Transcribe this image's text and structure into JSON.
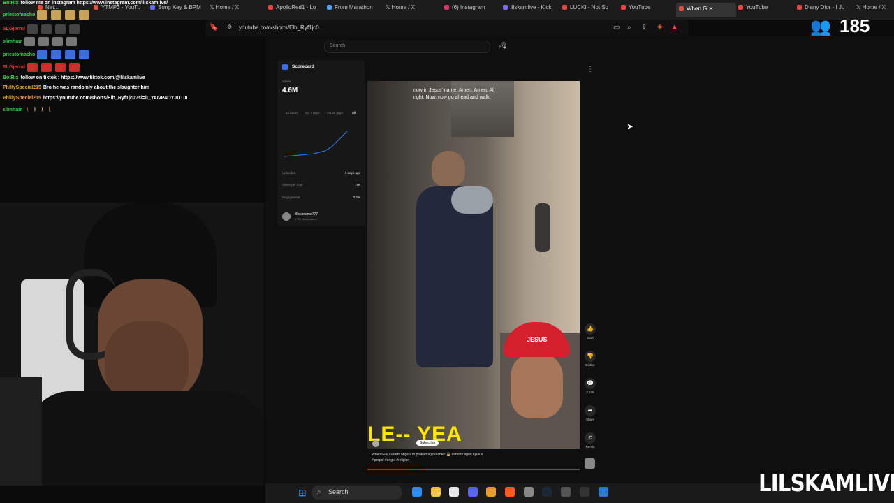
{
  "browser": {
    "tabs": [
      {
        "label": "Nat...",
        "color": "#e7473c"
      },
      {
        "label": "YTMP3 - YouTu",
        "color": "#e7473c"
      },
      {
        "label": "Song Key & BPM",
        "color": "#5b6cff"
      },
      {
        "label": "Home / X",
        "color": "#ffffff"
      },
      {
        "label": "ApolloRed1 - Lo",
        "color": "#e7473c"
      },
      {
        "label": "From Marathon",
        "color": "#4aa3ff"
      },
      {
        "label": "Home / X",
        "color": "#ffffff"
      },
      {
        "label": "(6) Instagram",
        "color": "#e1306c"
      },
      {
        "label": "lilskamlive - Kick",
        "color": "#7b6cff"
      },
      {
        "label": "LUCKI - Not So",
        "color": "#e7473c"
      },
      {
        "label": "YouTube",
        "color": "#e7473c"
      },
      {
        "label": "When G",
        "color": "#e7473c"
      },
      {
        "label": "YouTube",
        "color": "#e7473c"
      },
      {
        "label": "Diany Dior - I Ju",
        "color": "#e7473c"
      },
      {
        "label": "Home / X",
        "color": "#ffffff"
      }
    ],
    "url": "youtube.com/shorts/Elb_Ryf1jc0"
  },
  "viewer_count": "185",
  "youtube": {
    "search_placeholder": "Search",
    "scorecard": {
      "title": "Scorecard",
      "views_label": "Views",
      "views": "4.6M",
      "ranges": [
        "24 hours",
        "1st 7 days",
        "1st 28 days",
        "All"
      ],
      "uploaded_label": "Uploaded",
      "uploaded": "6 days ago",
      "vph_label": "Views per hour",
      "vph": "75K",
      "engagement_label": "Engagement",
      "engagement": "3.2%",
      "channel": "Blessedme777",
      "subscribers": "173K Subscribers"
    },
    "caption_line1": "now in Jesus' name. Amen. Amen. All",
    "caption_line2": "right. Now, now go ahead and walk.",
    "overlay_text": "LE-- YEA",
    "cap_text": "JESUS",
    "subscribe": "Subscribe",
    "description_line1": "When GOD sends angels to protect a preacher! 👼 #shorts #god #jesus",
    "description_line2": "#gospel #angel #religion",
    "actions": [
      {
        "icon": "👍",
        "label": "151K"
      },
      {
        "icon": "👎",
        "label": "Dislike"
      },
      {
        "icon": "💬",
        "label": "2,525"
      },
      {
        "icon": "➦",
        "label": "Share"
      },
      {
        "icon": "⟲",
        "label": "Remix"
      }
    ]
  },
  "chat": [
    {
      "user": "BotRix",
      "msg": "follow me on instagram https://www.instagram.com/lilskamlive/"
    },
    {
      "user": "priestofnacho",
      "msg": ""
    },
    {
      "user": "SLGjerrol",
      "msg": ""
    },
    {
      "user": "slimham",
      "msg": ""
    },
    {
      "user": "priestofnacho",
      "msg": ""
    },
    {
      "user": "SLGjerrol",
      "msg": ""
    },
    {
      "user": "BotRix",
      "msg": "follow on tiktok : https://www.tiktok.com/@lilskamlive"
    },
    {
      "user": "PhillySpecial215",
      "msg": "Bro he was randomly about the slaughter him"
    },
    {
      "user": "PhillySpecial215",
      "msg": "https://youtube.com/shorts/Elb_Ryf1jc0?si=lI_YAIvP4OYJDT0I"
    },
    {
      "user": "slimham",
      "msg": "🚶 🚶 🚶 🚶"
    }
  ],
  "taskbar": {
    "search_label": "Search"
  },
  "brand": "LILSKAMLIVE"
}
